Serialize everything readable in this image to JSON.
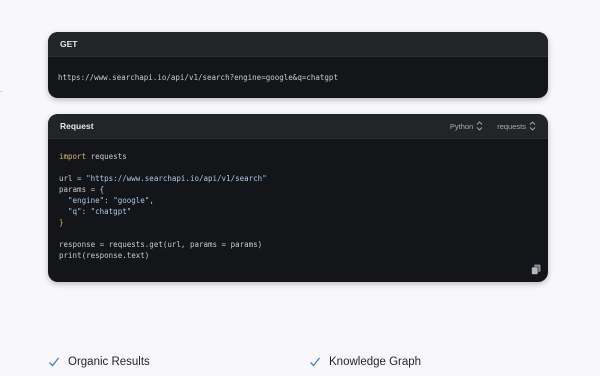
{
  "get_card": {
    "method": "GET",
    "url": "https://www.searchapi.io/api/v1/search?engine=google&q=chatgpt"
  },
  "request_card": {
    "title": "Request",
    "language": "Python",
    "library": "requests",
    "code": {
      "line1_kw": "import",
      "line1_rest": " requests",
      "line3_var": "url",
      "line3_op": " = ",
      "line3_str": "\"https://www.searchapi.io/api/v1/search\"",
      "line4": "params = {",
      "line5_key": "  \"engine\"",
      "line5_sep": ": ",
      "line5_val": "\"google\"",
      "line5_end": ",",
      "line6_key": "  \"q\"",
      "line6_sep": ": ",
      "line6_val": "\"chatgpt\"",
      "line7": "}",
      "line9": "response = requests.get(url, params = params)",
      "line10": "print(response.text)"
    }
  },
  "features": {
    "left": "Organic Results",
    "right": "Knowledge Graph"
  },
  "colors": {
    "check": "#4a7cc9",
    "card_bg": "#141518",
    "header_bg": "#232428",
    "page_bg": "#f8f8fa"
  },
  "icons": {
    "selector": "chevron-up-down-icon",
    "copy": "copy-icon",
    "check": "check-icon"
  }
}
